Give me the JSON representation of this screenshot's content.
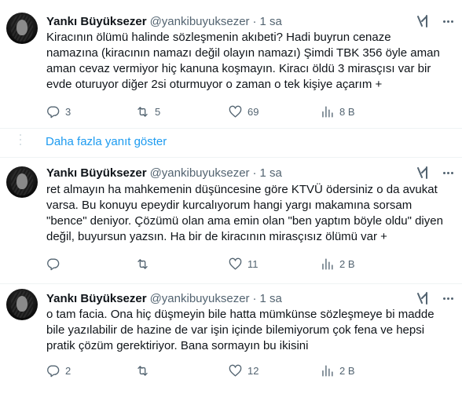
{
  "tweets": [
    {
      "author_name": "Yankı Büyüksezer",
      "handle": "@yankibuyuksezer",
      "separator": "·",
      "time": "1 sa",
      "lines": [
        "Kiracının ölümü halinde sözleşmenin akıbeti? Hadi buyrun cenaze",
        "namazına (kiracının namazı değil olayın namazı) Şimdi TBK 356 öyle aman",
        "aman cevaz vermiyor hiç kanuna koşmayın. Kiracı öldü 3 mirasçısı var bir",
        "evde oturuyor diğer 2si oturmuyor o zaman o tek kişiye açarım +"
      ],
      "replies": "3",
      "retweets": "5",
      "likes": "69",
      "views": "8 B"
    },
    {
      "author_name": "Yankı Büyüksezer",
      "handle": "@yankibuyuksezer",
      "separator": "·",
      "time": "1 sa",
      "lines": [
        "ret almayın ha mahkemenin düşüncesine göre KTVÜ ödersiniz o da avukat",
        "varsa. Bu konuyu epeydir kurcalıyorum hangi yargı makamına sorsam",
        "\"bence\" deniyor. Çözümü olan ama emin olan \"ben yaptım böyle oldu\" diyen",
        "değil, buyursun yazsın. Ha bir de kiracının mirasçısız ölümü var +"
      ],
      "replies": "",
      "retweets": "",
      "likes": "11",
      "views": "2 B"
    },
    {
      "author_name": "Yankı Büyüksezer",
      "handle": "@yankibuyuksezer",
      "separator": "·",
      "time": "1 sa",
      "lines": [
        "o tam facia. Ona hiç düşmeyin bile hatta mümkünse sözleşmeye bi madde",
        "bile yazılabilir de hazine de var işin içinde bilemiyorum çok fena ve hepsi",
        "pratik çözüm gerektiriyor. Bana sormayın bu ikisini"
      ],
      "replies": "2",
      "retweets": "",
      "likes": "12",
      "views": "2 B"
    }
  ],
  "show_more_replies": "Daha fazla yanıt göster",
  "icons": {
    "reply": "reply-icon",
    "retweet": "retweet-icon",
    "like": "heart-icon",
    "views": "views-icon",
    "grok": "grok-icon",
    "more": "more-icon"
  },
  "colors": {
    "link": "#1d9bf0",
    "muted": "#536471",
    "text": "#0f1419",
    "divider": "#eff3f4"
  }
}
